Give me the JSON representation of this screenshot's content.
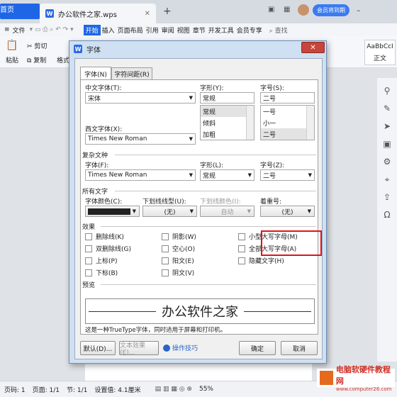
{
  "app": {
    "home_tab": "首页",
    "doc_tab": "办公软件之家.wps",
    "member": "会员将到期"
  },
  "menu": [
    "文件",
    "开始",
    "插入",
    "页面布局",
    "引用",
    "审阅",
    "视图",
    "章节",
    "开发工具",
    "会员专享",
    "查找"
  ],
  "ribbon": {
    "cut": "剪切",
    "copy": "复制",
    "paste": "粘贴",
    "format": "格式",
    "style": "AaBbCcI",
    "style_label": "正文"
  },
  "dialog": {
    "title": "字体",
    "close": "✕",
    "tabs": [
      "字体(N)",
      "字符间距(R)"
    ],
    "chinese_font_label": "中文字体(T):",
    "chinese_font": "宋体",
    "style_label": "字形(Y):",
    "style_value": "常规",
    "style_options": [
      "常规",
      "倾斜",
      "加粗"
    ],
    "size_label": "字号(S):",
    "size_value": "二号",
    "size_options": [
      "一号",
      "小一",
      "二号"
    ],
    "western_font_label": "西文字体(X):",
    "western_font": "Times New Roman",
    "complex_section": "复杂文种",
    "complex_font_label": "字体(F):",
    "complex_font": "Times New Roman",
    "complex_style_label": "字形(L):",
    "complex_style": "常规",
    "complex_size_label": "字号(Z):",
    "complex_size": "二号",
    "all_text_section": "所有文字",
    "font_color_label": "字体颜色(C):",
    "underline_type_label": "下划线线型(U):",
    "underline_type": "(无)",
    "underline_color_label": "下划线颜色(I):",
    "underline_color": "自动",
    "emphasis_label": "着重号:",
    "emphasis": "(无)",
    "effects_section": "效果",
    "effects": [
      [
        "删除线(K)",
        "阴影(W)",
        "小型大写字母(M)"
      ],
      [
        "双删除线(G)",
        "空心(O)",
        "全部大写字母(A)"
      ],
      [
        "上标(P)",
        "阳文(E)",
        "隐藏文字(H)"
      ],
      [
        "下标(B)",
        "阴文(V)",
        ""
      ]
    ],
    "preview_section": "预览",
    "preview_text": "办公软件之家",
    "hint": "这是一种TrueType字体，同时适用于屏幕和打印机。",
    "default_btn": "默认(D)...",
    "text_effect_btn": "文本效果(E)...",
    "tips_btn": "操作技巧",
    "ok": "确定",
    "cancel": "取消"
  },
  "status": {
    "page": "页码: 1",
    "pages": "页面: 1/1",
    "section": "节: 1/1",
    "settings": "设置值: 4.1厘米",
    "zoom": "55%"
  },
  "watermark": {
    "line1": "电脑软硬件教程网",
    "line2": "www.computer26.com"
  },
  "colors": {
    "accent": "#1f66e6",
    "red": "#e0141a"
  }
}
